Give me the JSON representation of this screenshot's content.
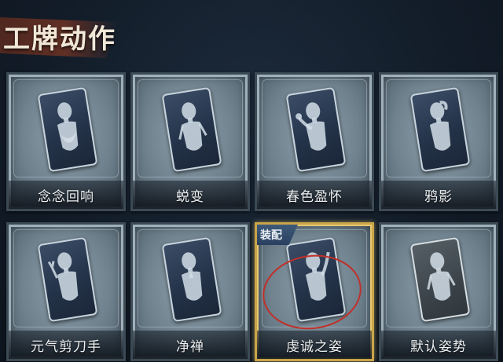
{
  "header": {
    "title": "工牌动作"
  },
  "cards": [
    {
      "label": "念念回响",
      "state": "normal",
      "pose": "hug"
    },
    {
      "label": "蜕变",
      "state": "normal",
      "pose": "arms-down"
    },
    {
      "label": "春色盈怀",
      "state": "normal",
      "pose": "flower"
    },
    {
      "label": "鸦影",
      "state": "normal",
      "pose": "hand-on-head"
    },
    {
      "label": "元气剪刀手",
      "state": "normal",
      "pose": "peace-sign"
    },
    {
      "label": "净禅",
      "state": "normal",
      "pose": "pray"
    },
    {
      "label": "虔诚之姿",
      "state": "equipped",
      "pose": "raise-hand",
      "badge": "装配"
    },
    {
      "label": "默认姿势",
      "state": "default",
      "pose": "standing"
    }
  ],
  "colors": {
    "accent_equipped": "#c9a449",
    "scribble": "#c0302a",
    "header_ribbon": "#6e3324"
  }
}
